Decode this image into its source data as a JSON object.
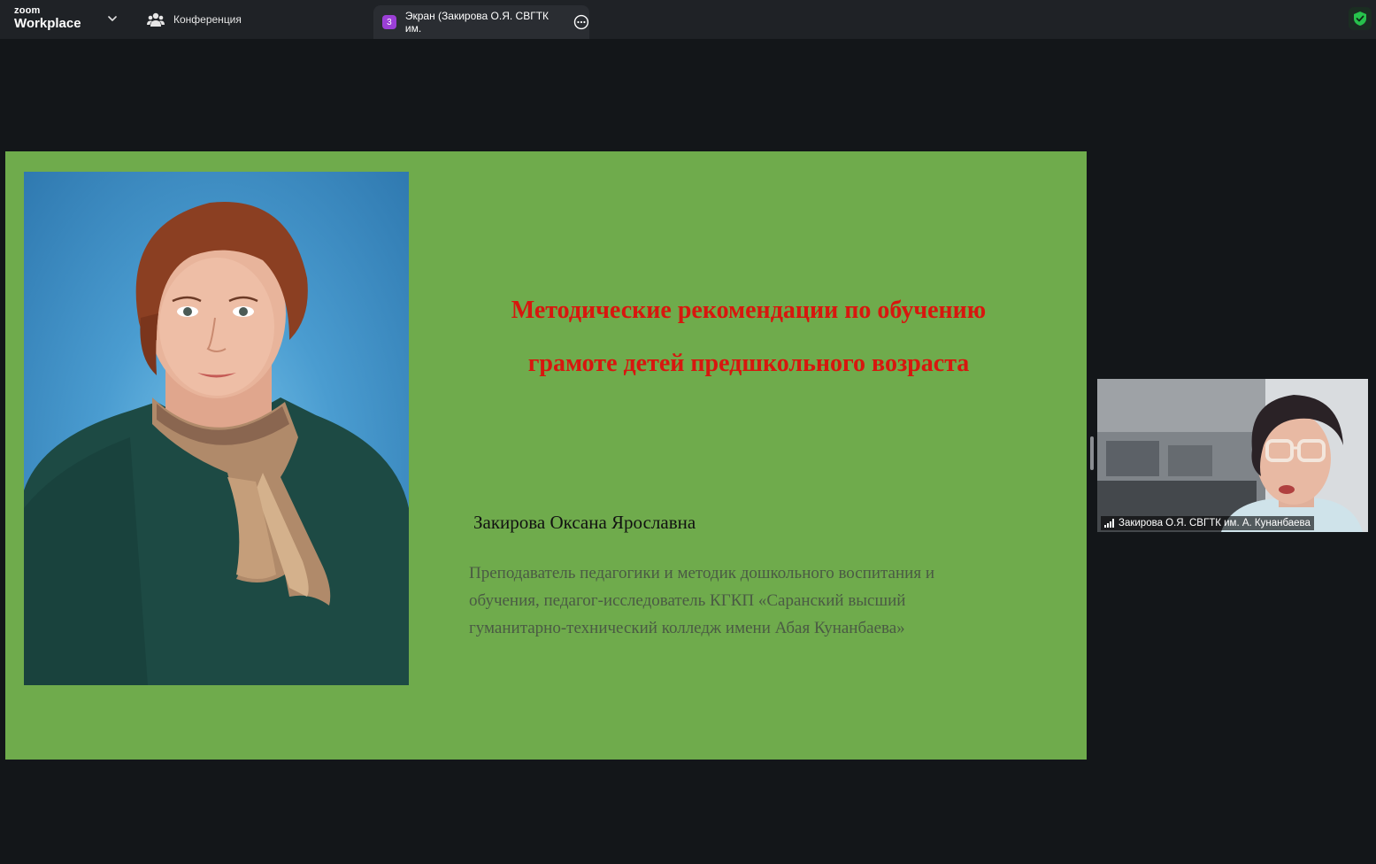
{
  "app": {
    "brand_top": "zoom",
    "brand_bottom": "Workplace"
  },
  "tabs": [
    {
      "label": "Конференция",
      "icon": "participants-icon"
    },
    {
      "label": "Экран (Закирова О.Я. СВГТК им.",
      "badge": "3",
      "icon": "more-icon"
    }
  ],
  "security_icon": "shield-check-icon",
  "slide": {
    "title_line1": "Методические рекомендации по обучению",
    "title_line2": "грамоте детей предшкольного возраста",
    "author_name": "Закирова Оксана Ярославна",
    "desc_line1": "Преподаватель педагогики и методик дошкольного воспитания и",
    "desc_line2": "обучения, педагог-исследователь КГКП «Саранский высший",
    "desc_line3": "гуманитарно-технический колледж имени Абая Кунанбаева»",
    "title_color": "#d8160e",
    "background_color": "#6fab4c"
  },
  "video": {
    "participant_name": "Закирова О.Я. СВГТК им. А. Кунанбаева"
  },
  "colors": {
    "topbar": "#1f2226",
    "active_tab": "#2a2d32",
    "badge": "#9b3fd6",
    "shield": "#27c24c",
    "canvas": "#131619"
  }
}
